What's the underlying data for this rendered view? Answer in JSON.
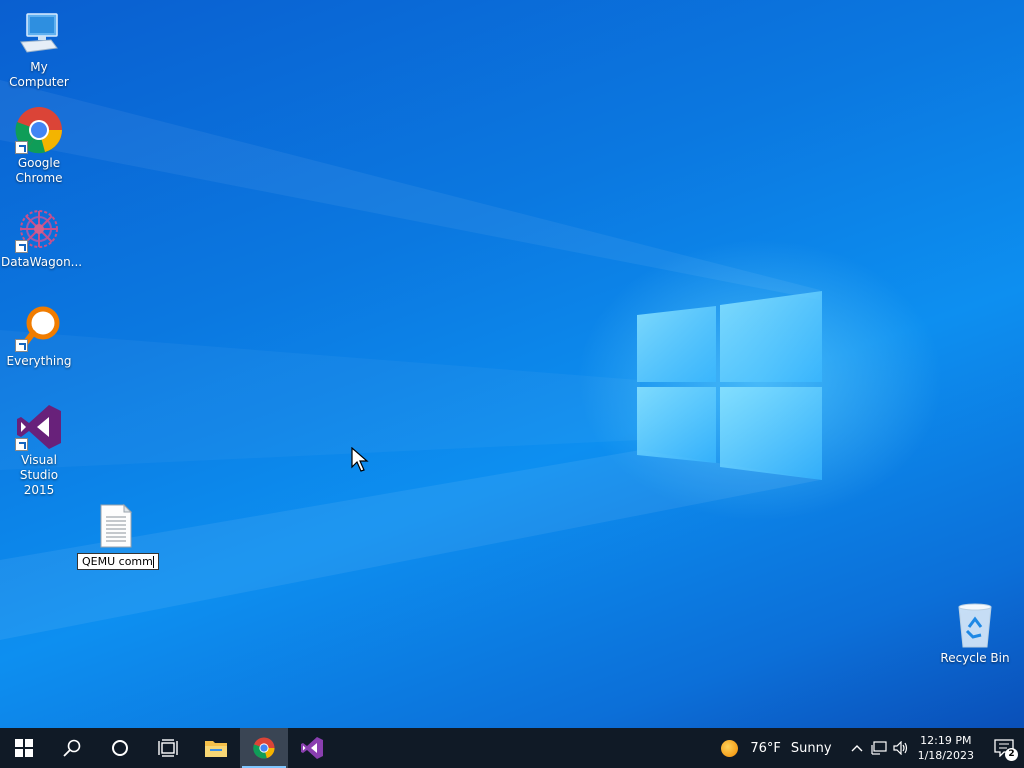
{
  "desktop": {
    "icons": [
      {
        "label": "My Computer",
        "icon": "computer-icon"
      },
      {
        "label": "Google\nChrome",
        "icon": "chrome-icon",
        "shortcut": true
      },
      {
        "label": "DataWagon...",
        "icon": "datawagon-icon",
        "shortcut": true
      },
      {
        "label": "Everything",
        "icon": "everything-search-icon",
        "shortcut": true
      },
      {
        "label": "Visual Studio\n2015",
        "icon": "visual-studio-icon",
        "shortcut": true
      }
    ],
    "rename_file": {
      "value": "QEMU comm",
      "icon": "text-file-icon"
    },
    "recycle_bin": {
      "label": "Recycle Bin",
      "icon": "recycle-bin-icon"
    }
  },
  "taskbar": {
    "buttons": [
      {
        "name": "start",
        "icon": "windows-start-icon"
      },
      {
        "name": "search",
        "icon": "search-icon"
      },
      {
        "name": "cortana",
        "icon": "cortana-circle-icon"
      },
      {
        "name": "task-view",
        "icon": "task-view-icon"
      },
      {
        "name": "file-explorer",
        "icon": "folder-icon"
      },
      {
        "name": "chrome",
        "icon": "chrome-icon",
        "active": true
      },
      {
        "name": "visual-studio",
        "icon": "visual-studio-icon"
      }
    ],
    "weather": {
      "temp": "76°F",
      "condition": "Sunny"
    },
    "clock": {
      "time": "12:19 PM",
      "date": "1/18/2023"
    },
    "notifications": {
      "count": "2"
    }
  },
  "colors": {
    "taskbar_bg": "#101a26",
    "accent": "#7fc6ff",
    "vs_purple": "#68217a"
  }
}
